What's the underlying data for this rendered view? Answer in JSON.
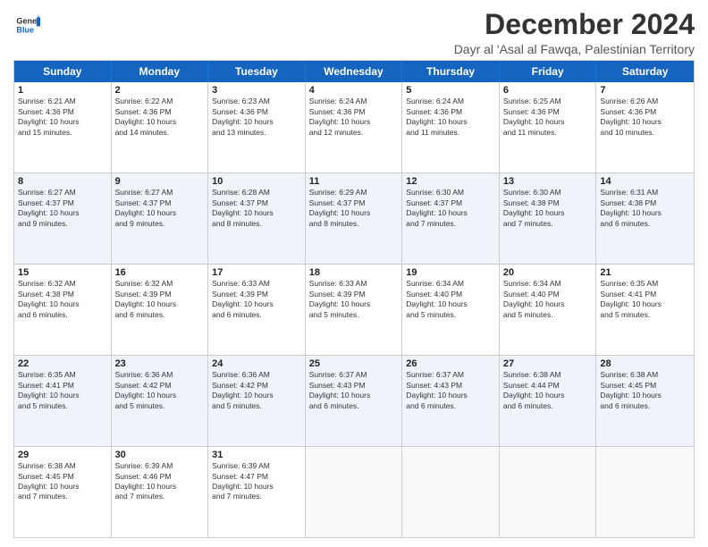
{
  "header": {
    "logo_line1": "General",
    "logo_line2": "Blue",
    "month_title": "December 2024",
    "subtitle": "Dayr al 'Asal al Fawqa, Palestinian Territory"
  },
  "days_of_week": [
    "Sunday",
    "Monday",
    "Tuesday",
    "Wednesday",
    "Thursday",
    "Friday",
    "Saturday"
  ],
  "rows": [
    [
      {
        "day": "1",
        "text": "Sunrise: 6:21 AM\nSunset: 4:36 PM\nDaylight: 10 hours\nand 15 minutes."
      },
      {
        "day": "2",
        "text": "Sunrise: 6:22 AM\nSunset: 4:36 PM\nDaylight: 10 hours\nand 14 minutes."
      },
      {
        "day": "3",
        "text": "Sunrise: 6:23 AM\nSunset: 4:36 PM\nDaylight: 10 hours\nand 13 minutes."
      },
      {
        "day": "4",
        "text": "Sunrise: 6:24 AM\nSunset: 4:36 PM\nDaylight: 10 hours\nand 12 minutes."
      },
      {
        "day": "5",
        "text": "Sunrise: 6:24 AM\nSunset: 4:36 PM\nDaylight: 10 hours\nand 11 minutes."
      },
      {
        "day": "6",
        "text": "Sunrise: 6:25 AM\nSunset: 4:36 PM\nDaylight: 10 hours\nand 11 minutes."
      },
      {
        "day": "7",
        "text": "Sunrise: 6:26 AM\nSunset: 4:36 PM\nDaylight: 10 hours\nand 10 minutes."
      }
    ],
    [
      {
        "day": "8",
        "text": "Sunrise: 6:27 AM\nSunset: 4:37 PM\nDaylight: 10 hours\nand 9 minutes."
      },
      {
        "day": "9",
        "text": "Sunrise: 6:27 AM\nSunset: 4:37 PM\nDaylight: 10 hours\nand 9 minutes."
      },
      {
        "day": "10",
        "text": "Sunrise: 6:28 AM\nSunset: 4:37 PM\nDaylight: 10 hours\nand 8 minutes."
      },
      {
        "day": "11",
        "text": "Sunrise: 6:29 AM\nSunset: 4:37 PM\nDaylight: 10 hours\nand 8 minutes."
      },
      {
        "day": "12",
        "text": "Sunrise: 6:30 AM\nSunset: 4:37 PM\nDaylight: 10 hours\nand 7 minutes."
      },
      {
        "day": "13",
        "text": "Sunrise: 6:30 AM\nSunset: 4:38 PM\nDaylight: 10 hours\nand 7 minutes."
      },
      {
        "day": "14",
        "text": "Sunrise: 6:31 AM\nSunset: 4:38 PM\nDaylight: 10 hours\nand 6 minutes."
      }
    ],
    [
      {
        "day": "15",
        "text": "Sunrise: 6:32 AM\nSunset: 4:38 PM\nDaylight: 10 hours\nand 6 minutes."
      },
      {
        "day": "16",
        "text": "Sunrise: 6:32 AM\nSunset: 4:39 PM\nDaylight: 10 hours\nand 6 minutes."
      },
      {
        "day": "17",
        "text": "Sunrise: 6:33 AM\nSunset: 4:39 PM\nDaylight: 10 hours\nand 6 minutes."
      },
      {
        "day": "18",
        "text": "Sunrise: 6:33 AM\nSunset: 4:39 PM\nDaylight: 10 hours\nand 5 minutes."
      },
      {
        "day": "19",
        "text": "Sunrise: 6:34 AM\nSunset: 4:40 PM\nDaylight: 10 hours\nand 5 minutes."
      },
      {
        "day": "20",
        "text": "Sunrise: 6:34 AM\nSunset: 4:40 PM\nDaylight: 10 hours\nand 5 minutes."
      },
      {
        "day": "21",
        "text": "Sunrise: 6:35 AM\nSunset: 4:41 PM\nDaylight: 10 hours\nand 5 minutes."
      }
    ],
    [
      {
        "day": "22",
        "text": "Sunrise: 6:35 AM\nSunset: 4:41 PM\nDaylight: 10 hours\nand 5 minutes."
      },
      {
        "day": "23",
        "text": "Sunrise: 6:36 AM\nSunset: 4:42 PM\nDaylight: 10 hours\nand 5 minutes."
      },
      {
        "day": "24",
        "text": "Sunrise: 6:36 AM\nSunset: 4:42 PM\nDaylight: 10 hours\nand 5 minutes."
      },
      {
        "day": "25",
        "text": "Sunrise: 6:37 AM\nSunset: 4:43 PM\nDaylight: 10 hours\nand 6 minutes."
      },
      {
        "day": "26",
        "text": "Sunrise: 6:37 AM\nSunset: 4:43 PM\nDaylight: 10 hours\nand 6 minutes."
      },
      {
        "day": "27",
        "text": "Sunrise: 6:38 AM\nSunset: 4:44 PM\nDaylight: 10 hours\nand 6 minutes."
      },
      {
        "day": "28",
        "text": "Sunrise: 6:38 AM\nSunset: 4:45 PM\nDaylight: 10 hours\nand 6 minutes."
      }
    ],
    [
      {
        "day": "29",
        "text": "Sunrise: 6:38 AM\nSunset: 4:45 PM\nDaylight: 10 hours\nand 7 minutes."
      },
      {
        "day": "30",
        "text": "Sunrise: 6:39 AM\nSunset: 4:46 PM\nDaylight: 10 hours\nand 7 minutes."
      },
      {
        "day": "31",
        "text": "Sunrise: 6:39 AM\nSunset: 4:47 PM\nDaylight: 10 hours\nand 7 minutes."
      },
      {
        "day": "",
        "text": ""
      },
      {
        "day": "",
        "text": ""
      },
      {
        "day": "",
        "text": ""
      },
      {
        "day": "",
        "text": ""
      }
    ]
  ]
}
